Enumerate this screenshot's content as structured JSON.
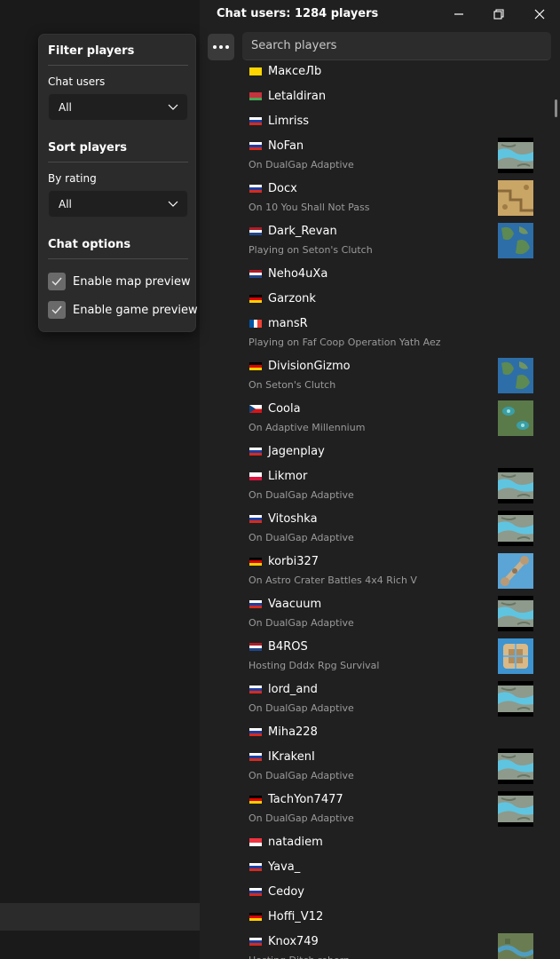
{
  "window": {
    "title": "Chat users: 1284 players"
  },
  "search": {
    "placeholder": "Search players"
  },
  "filter": {
    "filter_title": "Filter players",
    "chat_users_label": "Chat users",
    "chat_users_value": "All",
    "sort_title": "Sort players",
    "by_rating_label": "By rating",
    "by_rating_value": "All",
    "options_title": "Chat options",
    "map_preview_label": "Enable map preview",
    "map_preview_checked": true,
    "game_preview_label": "Enable game preview",
    "game_preview_checked": true
  },
  "players": [
    {
      "name": "МаксеЛb",
      "flag": "ua",
      "status": "",
      "map": ""
    },
    {
      "name": "Letaldiran",
      "flag": "by",
      "status": "",
      "map": ""
    },
    {
      "name": "Limriss",
      "flag": "ru",
      "status": "",
      "map": ""
    },
    {
      "name": "NoFan",
      "flag": "ru",
      "status": "On DualGap Adaptive",
      "map": "dualgap"
    },
    {
      "name": "Docx",
      "flag": "ru",
      "status": "On 10 You Shall Not Pass",
      "map": "desert"
    },
    {
      "name": "Dark_Revan",
      "flag": "nl",
      "status": "Playing on Seton's Clutch",
      "map": "seton"
    },
    {
      "name": "Neho4uXa",
      "flag": "nl",
      "status": "",
      "map": ""
    },
    {
      "name": "Garzonk",
      "flag": "de",
      "status": "",
      "map": ""
    },
    {
      "name": "mansR",
      "flag": "fr",
      "status": "Playing on Faf Coop Operation Yath Aez",
      "map": ""
    },
    {
      "name": "DivisionGizmo",
      "flag": "de",
      "status": "On Seton's Clutch",
      "map": "seton"
    },
    {
      "name": "Coola",
      "flag": "cz",
      "status": "On Adaptive Millennium",
      "map": "millennium"
    },
    {
      "name": "Jagenplay",
      "flag": "ru",
      "status": "",
      "map": ""
    },
    {
      "name": "Likmor",
      "flag": "pl",
      "status": "On DualGap Adaptive",
      "map": "dualgap"
    },
    {
      "name": "Vitoshka",
      "flag": "ru",
      "status": "On DualGap Adaptive",
      "map": "dualgap"
    },
    {
      "name": "korbi327",
      "flag": "de",
      "status": "On Astro Crater Battles 4x4 Rich V",
      "map": "astro"
    },
    {
      "name": "Vaacuum",
      "flag": "ru",
      "status": "On DualGap Adaptive",
      "map": "dualgap"
    },
    {
      "name": "B4ROS",
      "flag": "nl",
      "status": "Hosting Dddx Rpg Survival",
      "map": "rpg"
    },
    {
      "name": "lord_and",
      "flag": "ru",
      "status": "On DualGap Adaptive",
      "map": "dualgap"
    },
    {
      "name": "Miha228",
      "flag": "ru",
      "status": "",
      "map": ""
    },
    {
      "name": "IKrakenI",
      "flag": "ru",
      "status": "On DualGap Adaptive",
      "map": "dualgap"
    },
    {
      "name": "TachYon7477",
      "flag": "de",
      "status": "On DualGap Adaptive",
      "map": "dualgap"
    },
    {
      "name": "natadiem",
      "flag": "sg",
      "status": "",
      "map": ""
    },
    {
      "name": "Yava_",
      "flag": "ru",
      "status": "",
      "map": ""
    },
    {
      "name": "Cedoy",
      "flag": "ru",
      "status": "",
      "map": ""
    },
    {
      "name": "Hoffi_V12",
      "flag": "de",
      "status": "",
      "map": ""
    },
    {
      "name": "Knox749",
      "flag": "ru",
      "status": "Hosting Ditch reborn",
      "map": "ditch"
    }
  ],
  "flag_colors": {
    "ru": [
      "#ffffff",
      "#1c3fa3",
      "#d52b1e"
    ],
    "ua": [
      "#ffd500",
      "#ffd500"
    ],
    "by": [
      "#c8313e",
      "#c8313e",
      "#4aa657"
    ],
    "nl": [
      "#ae1c28",
      "#ffffff",
      "#21468b"
    ],
    "de": [
      "#000000",
      "#dd0000",
      "#ffce00"
    ],
    "pl": [
      "#ffffff",
      "#dc143c"
    ],
    "sg": [
      "#ef3340",
      "#ffffff"
    ],
    "fr": "vertical",
    "cz": "cz"
  },
  "icons": [
    "more-icon",
    "minimize-icon",
    "maximize-icon",
    "close-icon",
    "chevron-down-icon",
    "check-icon"
  ]
}
